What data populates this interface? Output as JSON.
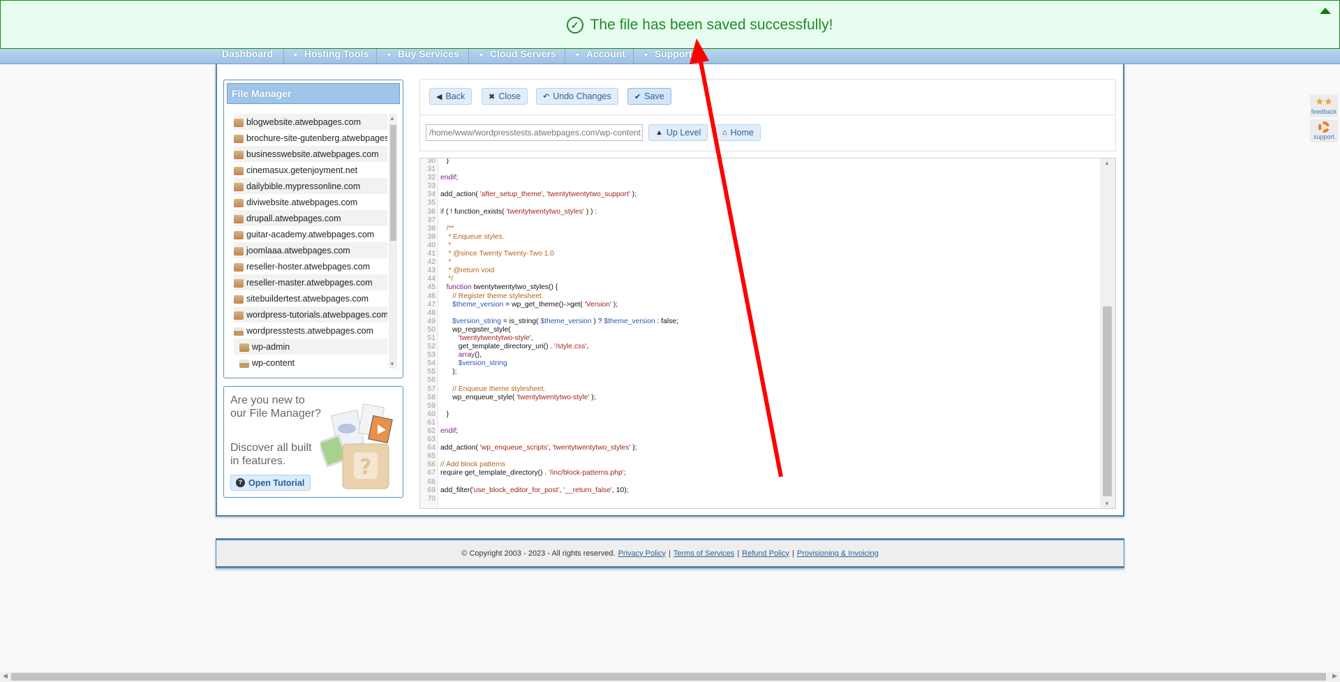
{
  "banner": {
    "message": "The file has been saved successfully!",
    "icon": "check-circle-icon",
    "color": "#1f8a24"
  },
  "nav": {
    "items": [
      {
        "label": "Dashboard",
        "dropdown": false
      },
      {
        "label": "Hosting Tools",
        "dropdown": true
      },
      {
        "label": "Buy Services",
        "dropdown": true
      },
      {
        "label": "Cloud Servers",
        "dropdown": true
      },
      {
        "label": "Account",
        "dropdown": true
      },
      {
        "label": "Support",
        "dropdown": true
      }
    ]
  },
  "file_manager": {
    "title": "File Manager",
    "tree": [
      {
        "name": "blogwebsite.atwebpages.com",
        "level": 0,
        "open": false
      },
      {
        "name": "brochure-site-gutenberg.atwebpages.com",
        "level": 0,
        "open": false
      },
      {
        "name": "businesswebsite.atwebpages.com",
        "level": 0,
        "open": false
      },
      {
        "name": "cinemasux.getenjoyment.net",
        "level": 0,
        "open": false
      },
      {
        "name": "dailybible.mypressonline.com",
        "level": 0,
        "open": false
      },
      {
        "name": "diviwebsite.atwebpages.com",
        "level": 0,
        "open": false
      },
      {
        "name": "drupall.atwebpages.com",
        "level": 0,
        "open": false
      },
      {
        "name": "guitar-academy.atwebpages.com",
        "level": 0,
        "open": false
      },
      {
        "name": "joomlaaa.atwebpages.com",
        "level": 0,
        "open": false
      },
      {
        "name": "reseller-hoster.atwebpages.com",
        "level": 0,
        "open": false
      },
      {
        "name": "reseller-master.atwebpages.com",
        "level": 0,
        "open": false
      },
      {
        "name": "sitebuildertest.atwebpages.com",
        "level": 0,
        "open": false
      },
      {
        "name": "wordpress-tutorials.atwebpages.com",
        "level": 0,
        "open": false
      },
      {
        "name": "wordpresstests.atwebpages.com",
        "level": 0,
        "open": true
      },
      {
        "name": "wp-admin",
        "level": 1,
        "open": false
      },
      {
        "name": "wp-content",
        "level": 1,
        "open": true
      }
    ]
  },
  "tutorial": {
    "line1": "Are you new to our File Manager?",
    "line2": "Discover all built in features.",
    "button": "Open Tutorial"
  },
  "toolbar": {
    "back": "Back",
    "close": "Close",
    "undo": "Undo Changes",
    "save": "Save",
    "path": "/home/www/wordpresstests.atwebpages.com/wp-content",
    "up_level": "Up Level",
    "home": "Home"
  },
  "editor": {
    "lines": [
      [
        30,
        [
          [
            "p",
            "\t}"
          ]
        ]
      ],
      [
        31,
        []
      ],
      [
        32,
        [
          [
            "kw",
            "endif"
          ],
          [
            "p",
            ";"
          ]
        ]
      ],
      [
        33,
        []
      ],
      [
        34,
        [
          [
            "p",
            "add_action( "
          ],
          [
            "str",
            "'after_setup_theme'"
          ],
          [
            "p",
            ", "
          ],
          [
            "str",
            "'twentytwentytwo_support'"
          ],
          [
            "p",
            " );"
          ]
        ]
      ],
      [
        35,
        []
      ],
      [
        36,
        [
          [
            "kw",
            "if"
          ],
          [
            "p",
            " ( ! function_exists( "
          ],
          [
            "str",
            "'twentytwentytwo_styles'"
          ],
          [
            "p",
            " ) ) :"
          ]
        ]
      ],
      [
        37,
        []
      ],
      [
        38,
        [
          [
            "com",
            "\t/**"
          ]
        ]
      ],
      [
        39,
        [
          [
            "com",
            "\t * Enqueue styles."
          ]
        ]
      ],
      [
        40,
        [
          [
            "com",
            "\t *"
          ]
        ]
      ],
      [
        41,
        [
          [
            "com",
            "\t * @since Twenty Twenty-Two 1.0"
          ]
        ]
      ],
      [
        42,
        [
          [
            "com",
            "\t *"
          ]
        ]
      ],
      [
        43,
        [
          [
            "com",
            "\t * @return void"
          ]
        ]
      ],
      [
        44,
        [
          [
            "com",
            "\t */"
          ]
        ]
      ],
      [
        45,
        [
          [
            "kw",
            "\tfunction"
          ],
          [
            "p",
            " twentytwentytwo_styles() {"
          ]
        ]
      ],
      [
        46,
        [
          [
            "com",
            "\t\t// Register theme stylesheet."
          ]
        ]
      ],
      [
        47,
        [
          [
            "var",
            "\t\t$theme_version"
          ],
          [
            "p",
            " = wp_get_theme()->get( "
          ],
          [
            "str",
            "'Version'"
          ],
          [
            "p",
            " );"
          ]
        ]
      ],
      [
        48,
        []
      ],
      [
        49,
        [
          [
            "var",
            "\t\t$version_string"
          ],
          [
            "p",
            " = is_string( "
          ],
          [
            "var",
            "$theme_version"
          ],
          [
            "p",
            " ) ? "
          ],
          [
            "var",
            "$theme_version"
          ],
          [
            "p",
            " : false;"
          ]
        ]
      ],
      [
        50,
        [
          [
            "p",
            "\t\twp_register_style("
          ]
        ]
      ],
      [
        51,
        [
          [
            "str",
            "\t\t\t'twentytwentytwo-style'"
          ],
          [
            "p",
            ","
          ]
        ]
      ],
      [
        52,
        [
          [
            "p",
            "\t\t\tget_template_directory_uri() . "
          ],
          [
            "str",
            "'/style.css'"
          ],
          [
            "p",
            ","
          ]
        ]
      ],
      [
        53,
        [
          [
            "kw",
            "\t\t\tarray"
          ],
          [
            "p",
            "(),"
          ]
        ]
      ],
      [
        54,
        [
          [
            "var",
            "\t\t\t$version_string"
          ]
        ]
      ],
      [
        55,
        [
          [
            "p",
            "\t\t);"
          ]
        ]
      ],
      [
        56,
        []
      ],
      [
        57,
        [
          [
            "com",
            "\t\t// Enqueue theme stylesheet."
          ]
        ]
      ],
      [
        58,
        [
          [
            "p",
            "\t\twp_enqueue_style( "
          ],
          [
            "str",
            "'twentytwentytwo-style'"
          ],
          [
            "p",
            " );"
          ]
        ]
      ],
      [
        59,
        []
      ],
      [
        60,
        [
          [
            "p",
            "\t}"
          ]
        ]
      ],
      [
        61,
        []
      ],
      [
        62,
        [
          [
            "kw",
            "endif"
          ],
          [
            "p",
            ";"
          ]
        ]
      ],
      [
        63,
        []
      ],
      [
        64,
        [
          [
            "p",
            "add_action( "
          ],
          [
            "str",
            "'wp_enqueue_scripts'"
          ],
          [
            "p",
            ", "
          ],
          [
            "str",
            "'twentytwentytwo_styles'"
          ],
          [
            "p",
            " );"
          ]
        ]
      ],
      [
        65,
        []
      ],
      [
        66,
        [
          [
            "com",
            "// Add block patterns"
          ]
        ]
      ],
      [
        67,
        [
          [
            "p",
            "require get_template_directory() . "
          ],
          [
            "str",
            "'/inc/block-patterns.php'"
          ],
          [
            "p",
            ";"
          ]
        ]
      ],
      [
        68,
        []
      ],
      [
        69,
        [
          [
            "p",
            "add_filter("
          ],
          [
            "str",
            "'use_block_editor_for_post'"
          ],
          [
            "p",
            ", "
          ],
          [
            "str",
            "'__return_false'"
          ],
          [
            "p",
            ", 10);"
          ]
        ]
      ],
      [
        70,
        []
      ]
    ]
  },
  "footer": {
    "copyright": "© Copyright 2003 - 2023 - All rights reserved.",
    "links": [
      "Privacy Policy",
      "Terms of Services",
      "Refund Policy",
      "Provisioning & Invoicing"
    ],
    "separator": "|"
  },
  "side": {
    "feedback": "feedback",
    "support": "support"
  },
  "annotation": {
    "color": "#ff0000",
    "shape": "arrow"
  }
}
